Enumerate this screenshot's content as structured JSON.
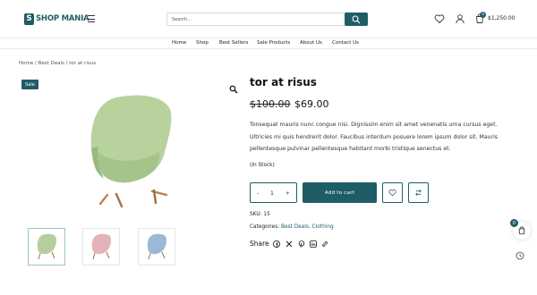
{
  "brand": {
    "logo_letter": "S",
    "name": "SHOP MANIA"
  },
  "search": {
    "placeholder": "Search..."
  },
  "header": {
    "cart_count": "0",
    "cart_total": "$1,250.00"
  },
  "nav": {
    "items": [
      "Home",
      "Shop",
      "Best Sellers",
      "Sale Products",
      "About Us",
      "Contact Us"
    ]
  },
  "breadcrumb": "Home / Best Deals / tor at risus",
  "product": {
    "badge": "Sale",
    "title": "tor at risus",
    "price_old": "$100.00",
    "price_new": "$69.00",
    "description": "Tonsequat mauris nunc congue nisi. Dignissim enim sit amet venenatis urna cursus eget. Ultricies mi quis hendrerit dolor. Faucibus interdum posuere lorem ipsum dolor sit. Mauris pellentesque pulvinar pellentesque habitant morbi tristique senectus et.",
    "stock": "(In Stock)",
    "quantity": "1",
    "qty_minus": "-",
    "qty_plus": "+",
    "add_to_cart": "Add to cart",
    "sku_label": "SKU:",
    "sku": "15",
    "categories_label": "Categories:",
    "categories": "Best Deals, Clothing",
    "share_label": "Share",
    "thumbnails": [
      "green chair",
      "pink chair",
      "blue chair"
    ]
  },
  "floating": {
    "cart_count": "0"
  },
  "colors": {
    "brand": "#1f5d66",
    "chair_green": "#b5cf9c",
    "chair_pink": "#e3b3b9",
    "chair_blue": "#9bb8d6"
  },
  "icons": [
    "hamburger-icon",
    "search-icon",
    "heart-icon",
    "user-icon",
    "cart-icon",
    "zoom-icon",
    "wishlist-icon",
    "compare-icon",
    "facebook-icon",
    "x-icon",
    "pinterest-icon",
    "linkedin-icon",
    "link-icon",
    "history-icon"
  ]
}
